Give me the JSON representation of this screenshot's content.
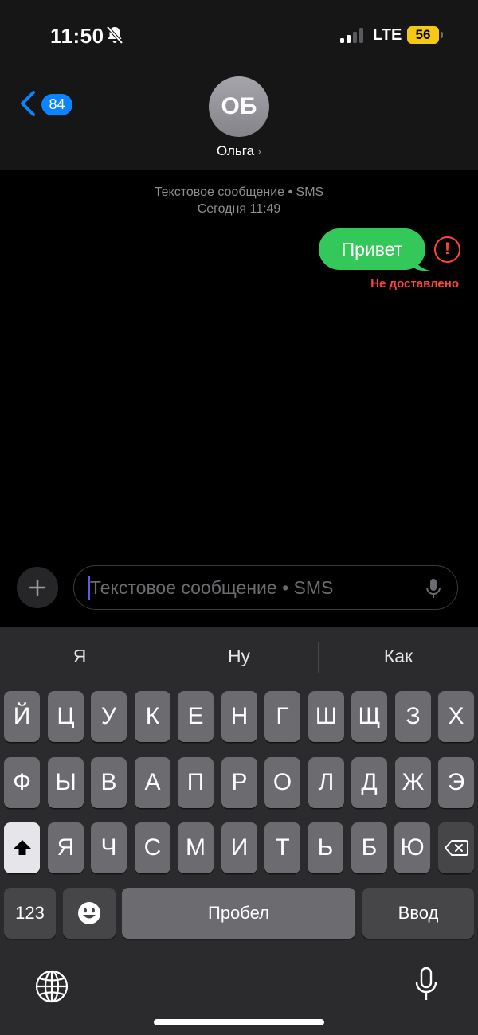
{
  "status_bar": {
    "time": "11:50",
    "network": "LTE",
    "battery": "56"
  },
  "header": {
    "back_count": "84",
    "avatar_initials": "ОБ",
    "contact_name": "Ольга"
  },
  "conversation": {
    "service_label": "Текстовое сообщение • SMS",
    "timestamp": "Сегодня 11:49",
    "messages": [
      {
        "text": "Привет",
        "status": "Не доставлено"
      }
    ]
  },
  "composer": {
    "placeholder": "Текстовое сообщение • SMS"
  },
  "keyboard": {
    "suggestions": [
      "Я",
      "Ну",
      "Как"
    ],
    "row1": [
      "Й",
      "Ц",
      "У",
      "К",
      "Е",
      "Н",
      "Г",
      "Ш",
      "Щ",
      "З",
      "Х"
    ],
    "row2": [
      "Ф",
      "Ы",
      "В",
      "А",
      "П",
      "Р",
      "О",
      "Л",
      "Д",
      "Ж",
      "Э"
    ],
    "row3": [
      "Я",
      "Ч",
      "С",
      "М",
      "И",
      "Т",
      "Ь",
      "Б",
      "Ю"
    ],
    "numbers_label": "123",
    "space_label": "Пробел",
    "return_label": "Ввод"
  },
  "colors": {
    "accent": "#0a84ff",
    "sent_bubble": "#34c759",
    "error": "#ff453a",
    "battery": "#f4c814"
  }
}
